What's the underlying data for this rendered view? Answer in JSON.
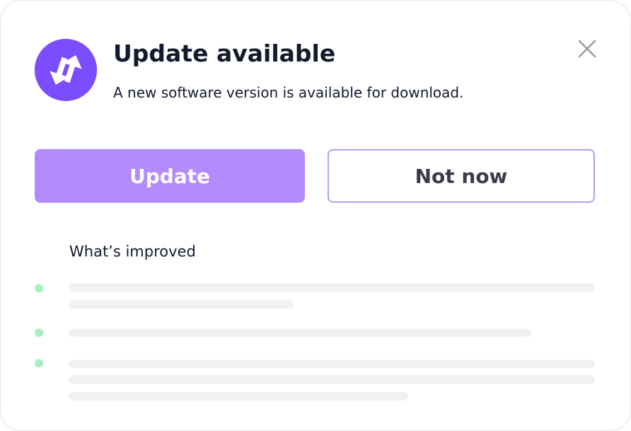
{
  "dialog": {
    "title": "Update available",
    "subtitle": "A new software version is available for download.",
    "app_icon": "sync-arrows-icon",
    "close_icon": "close-icon"
  },
  "actions": {
    "update_label": "Update",
    "not_now_label": "Not now"
  },
  "improvements": {
    "heading": "What’s improved",
    "items": [
      {
        "placeholder_lines": 2
      },
      {
        "placeholder_lines": 1
      },
      {
        "placeholder_lines": 3
      }
    ]
  },
  "colors": {
    "accent": "#7c4dff",
    "primary_button": "#b38bfc",
    "outline_border": "#b89cf5",
    "bullet": "#a8efbe",
    "placeholder": "#f1f1f3",
    "text": "#141a2e"
  }
}
